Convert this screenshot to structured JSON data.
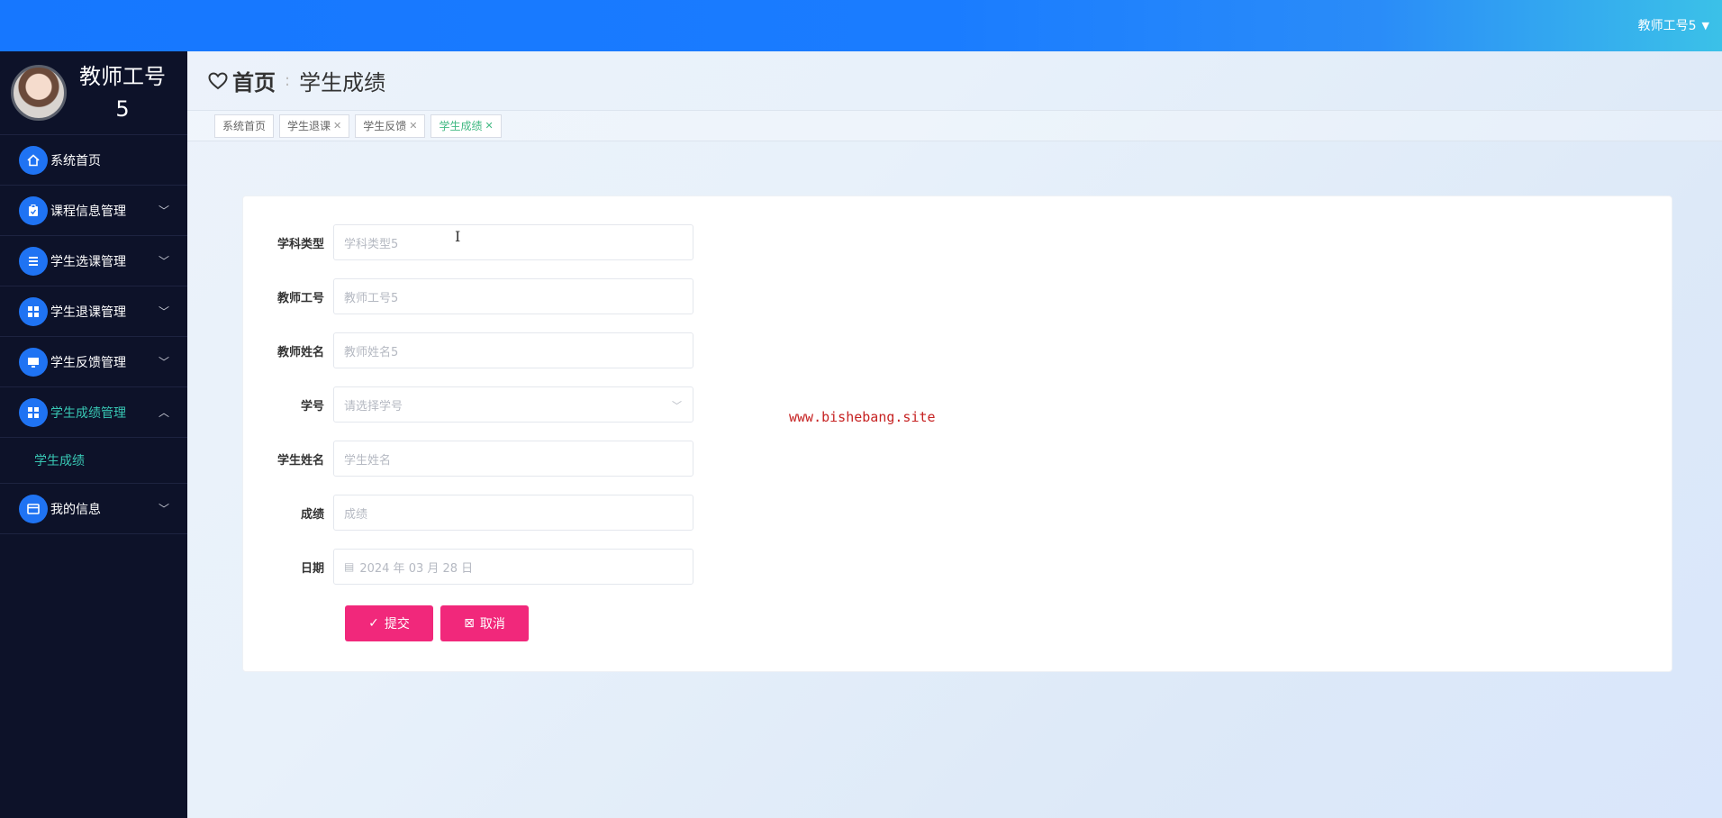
{
  "topbar": {
    "user": "教师工号5"
  },
  "sidebar": {
    "profile_name": "教师工号5",
    "items": [
      {
        "label": "系统首页",
        "icon": "home-icon"
      },
      {
        "label": "课程信息管理",
        "icon": "clipboard-icon"
      },
      {
        "label": "学生选课管理",
        "icon": "list-icon"
      },
      {
        "label": "学生退课管理",
        "icon": "grid-icon"
      },
      {
        "label": "学生反馈管理",
        "icon": "monitor-icon"
      },
      {
        "label": "学生成绩管理",
        "icon": "grid-icon"
      },
      {
        "label": "我的信息",
        "icon": "card-icon"
      }
    ],
    "submenu_label": "学生成绩"
  },
  "breadcrumb": {
    "home": "首页",
    "current": "学生成绩"
  },
  "tabs": [
    {
      "label": "系统首页"
    },
    {
      "label": "学生退课"
    },
    {
      "label": "学生反馈"
    },
    {
      "label": "学生成绩"
    }
  ],
  "form": {
    "fields": [
      {
        "label": "学科类型",
        "value": "学科类型5"
      },
      {
        "label": "教师工号",
        "value": "教师工号5"
      },
      {
        "label": "教师姓名",
        "value": "教师姓名5"
      },
      {
        "label": "学号",
        "value": "请选择学号"
      },
      {
        "label": "学生姓名",
        "value": "学生姓名"
      },
      {
        "label": "成绩",
        "value": "成绩"
      },
      {
        "label": "日期",
        "value": "2024 年 03 月 28 日"
      }
    ],
    "submit_label": "提交",
    "cancel_label": "取消"
  },
  "watermark": "www.bishebang.site",
  "colors": {
    "accent": "#1677ff",
    "sidebar_bg": "#0d1229",
    "active_text": "#38c7b4",
    "button": "#f1287b"
  }
}
